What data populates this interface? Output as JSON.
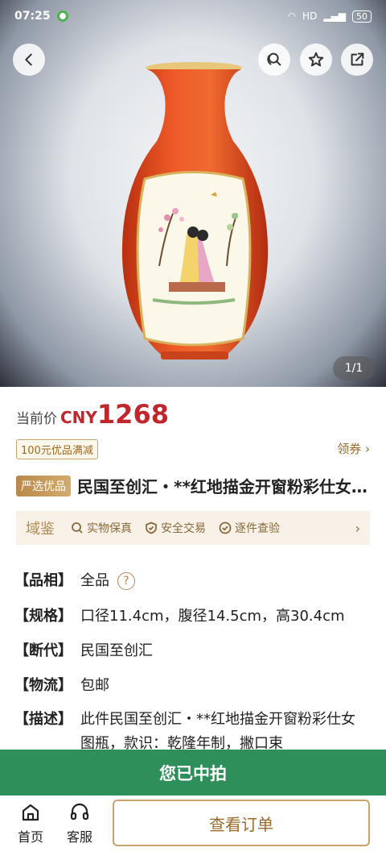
{
  "status_bar": {
    "time": "07:25",
    "network": "HD",
    "battery": "50"
  },
  "gallery": {
    "counter": "1/1",
    "image_alt": "vase photo"
  },
  "price": {
    "label": "当前价",
    "currency": "CNY",
    "value": "1268"
  },
  "coupon": {
    "tag": "100元优品满减",
    "link": "领券 ›"
  },
  "product": {
    "badge": "严选优品",
    "title": "民国至创汇・**红地描金开窗粉彩仕女图瓶"
  },
  "assurance": {
    "logo": "域鉴",
    "items": [
      "实物保真",
      "安全交易",
      "逐件查验"
    ],
    "arrow": "›"
  },
  "specs": [
    {
      "key": "【品相】",
      "value": "全品"
    },
    {
      "key": "【规格】",
      "value": "口径11.4cm，腹径14.5cm，高30.4cm"
    },
    {
      "key": "【断代】",
      "value": "民国至创汇"
    },
    {
      "key": "【物流】",
      "value": "包邮"
    },
    {
      "key": "【描述】",
      "value": "此件民国至创汇・**红地描金开窗粉彩仕女图瓶，款识：乾隆年制，撇口束"
    }
  ],
  "won_banner": "您已中拍",
  "bottom_nav": {
    "home": "首页",
    "service": "客服",
    "view_order": "查看订单"
  },
  "colors": {
    "accent": "#c0272d",
    "gold": "#c9a36b",
    "green": "#2f8f5b"
  }
}
